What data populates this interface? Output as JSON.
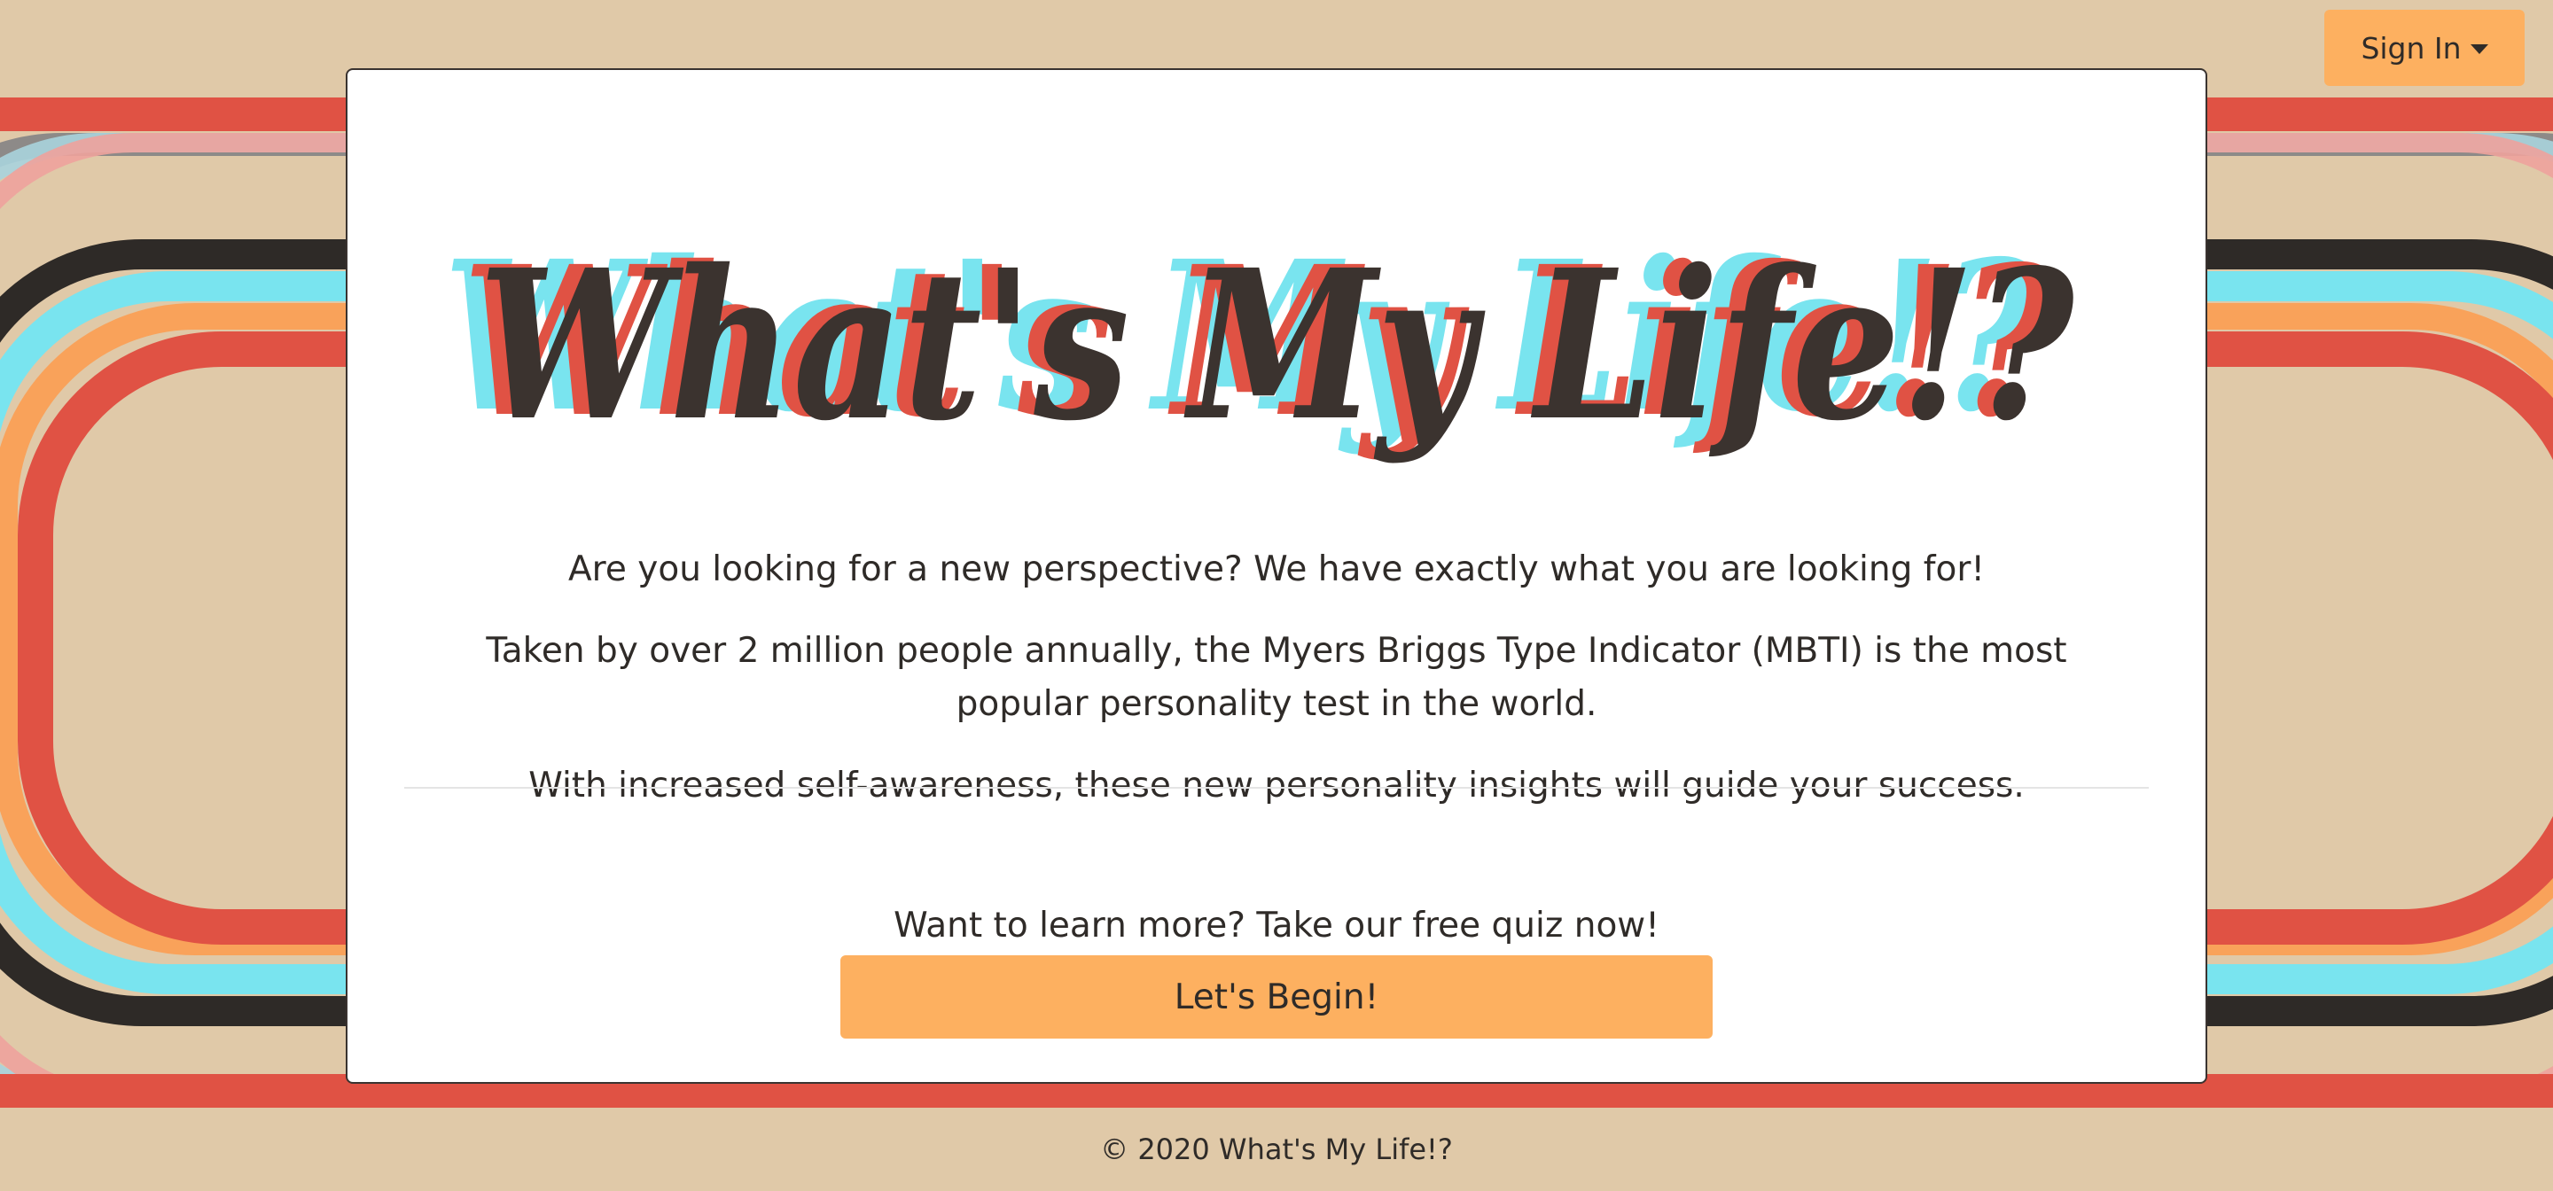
{
  "header": {
    "sign_in_label": "Sign In"
  },
  "hero": {
    "logo_text": "What's My Life!?",
    "paragraphs": [
      "Are you looking for a new perspective? We have exactly what you are looking for!",
      "Taken by over 2 million people annually, the Myers Briggs Type Indicator (MBTI) is the most popular personality test in the world.",
      "With increased self-awareness, these new personality insights will guide your success."
    ],
    "cta_prompt": "Want to learn more? Take our free quiz now!",
    "begin_label": "Let's Begin!"
  },
  "footer": {
    "copyright": "© 2020 What's My Life!?"
  },
  "colors": {
    "background": "#e0c9a8",
    "button": "#fdb060",
    "red": "#e05244",
    "cyan": "#79e4ef",
    "orange": "#f9a25a",
    "dark": "#2e2a27"
  }
}
